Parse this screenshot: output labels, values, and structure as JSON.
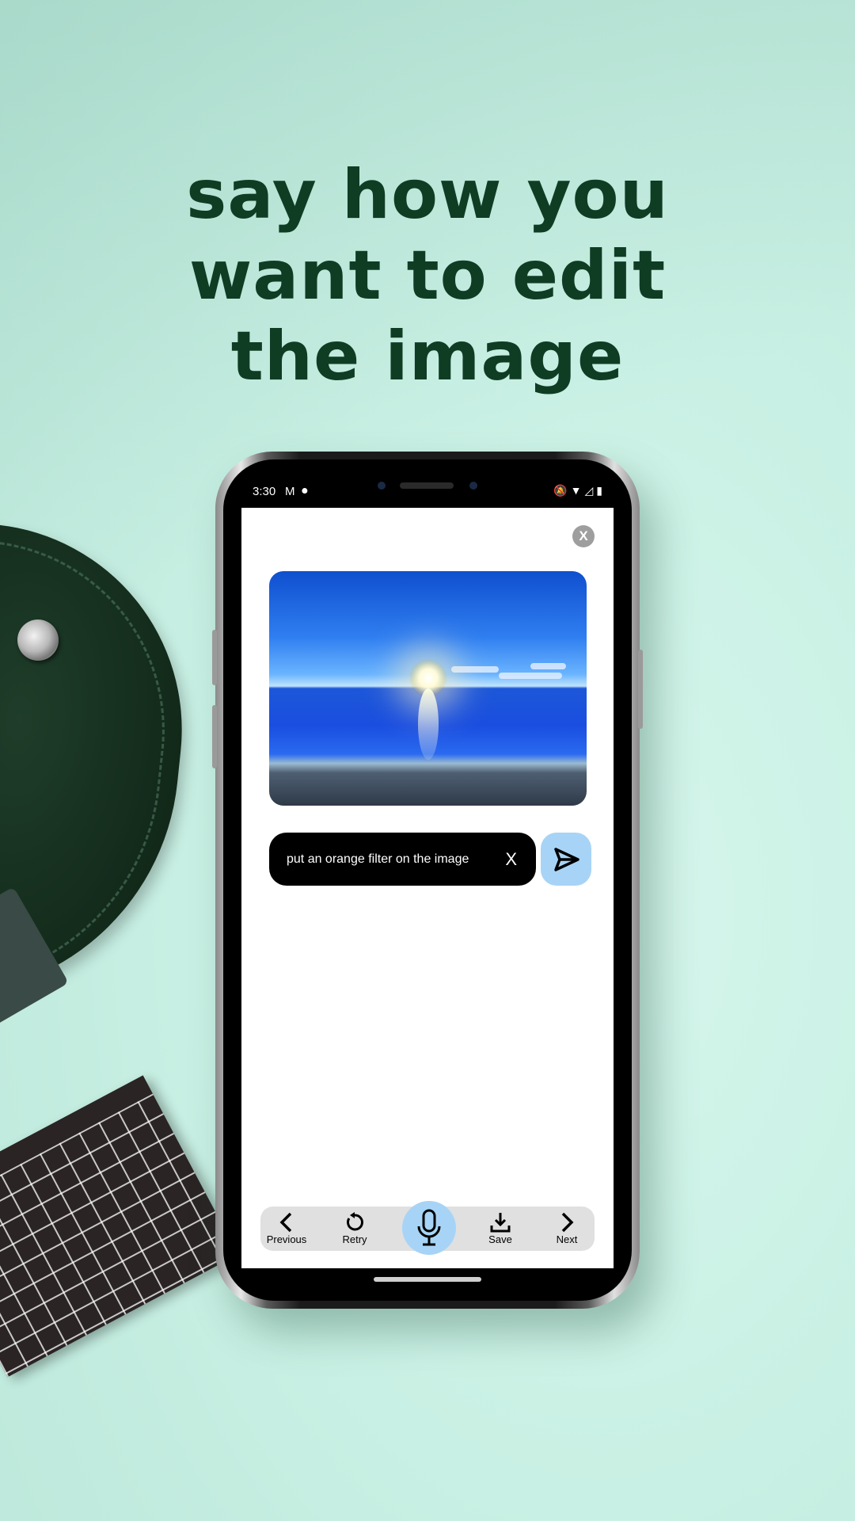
{
  "headline": {
    "line1": "say how you",
    "line2": "want to edit",
    "line3": "the image"
  },
  "status_bar": {
    "time": "3:30",
    "left_icons": [
      "gmail-icon",
      "keyhole-icon"
    ],
    "right_icons": [
      "bell-off-icon",
      "wifi-icon",
      "signal-icon",
      "battery-icon"
    ]
  },
  "editor": {
    "close_label": "X",
    "prompt": {
      "text": "put an orange filter on the image",
      "clear_label": "X"
    }
  },
  "toolbar": {
    "previous_label": "Previous",
    "retry_label": "Retry",
    "save_label": "Save",
    "next_label": "Next"
  },
  "colors": {
    "background": "#c9f0e4",
    "headline": "#0f3d24",
    "accent": "#a7d4f6",
    "toolbar": "#e0e0e0"
  }
}
